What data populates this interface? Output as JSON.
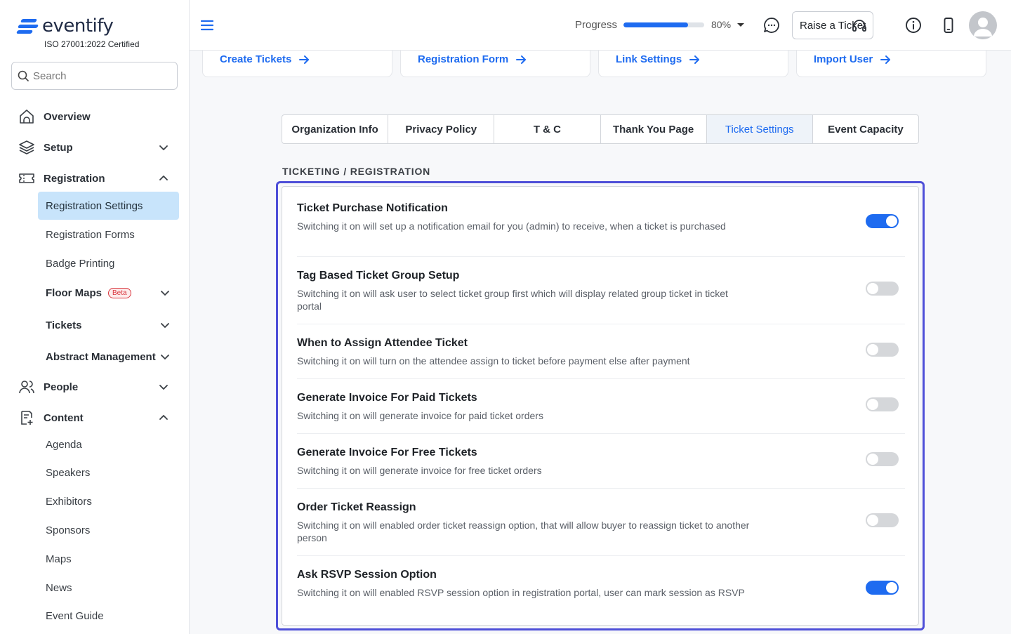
{
  "brand": {
    "name": "eventify",
    "cert": "ISO 27001:2022 Certified"
  },
  "search": {
    "placeholder": "Search"
  },
  "sidebar": {
    "items": [
      {
        "label": "Overview"
      },
      {
        "label": "Setup"
      },
      {
        "label": "Registration"
      },
      {
        "label": "People"
      },
      {
        "label": "Content"
      }
    ],
    "registration_sub": [
      {
        "label": "Registration Settings"
      },
      {
        "label": "Registration Forms"
      },
      {
        "label": "Badge Printing"
      },
      {
        "label": "Floor Maps",
        "badge": "Beta"
      },
      {
        "label": "Tickets"
      },
      {
        "label": "Abstract Management"
      }
    ],
    "content_sub": [
      {
        "label": "Agenda"
      },
      {
        "label": "Speakers"
      },
      {
        "label": "Exhibitors"
      },
      {
        "label": "Sponsors"
      },
      {
        "label": "Maps"
      },
      {
        "label": "News"
      },
      {
        "label": "Event Guide"
      }
    ]
  },
  "header": {
    "progress_label": "Progress",
    "progress_value": 0.8,
    "progress_text": "80%",
    "raise_ticket": "Raise a Ticket"
  },
  "quick_links": [
    {
      "label": "Create Tickets"
    },
    {
      "label": "Registration Form"
    },
    {
      "label": "Link Settings"
    },
    {
      "label": "Import User"
    }
  ],
  "tabs": [
    {
      "label": "Organization Info"
    },
    {
      "label": "Privacy Policy"
    },
    {
      "label": "T & C"
    },
    {
      "label": "Thank You Page"
    },
    {
      "label": "Ticket Settings",
      "active": true
    },
    {
      "label": "Event Capacity"
    }
  ],
  "section_title": "TICKETING / REGISTRATION",
  "settings": [
    {
      "title": "Ticket Purchase Notification",
      "desc": "Switching it on will set up a notification email for you (admin) to receive, when a ticket is purchased",
      "on": true
    },
    {
      "title": "Tag Based Ticket Group Setup",
      "desc": "Switching it on will ask user to select ticket group first which will display related group ticket in ticket portal",
      "on": false
    },
    {
      "title": "When to Assign Attendee Ticket",
      "desc": "Switching it on will turn on the attendee assign to ticket before payment else after payment",
      "on": false
    },
    {
      "title": "Generate Invoice For Paid Tickets",
      "desc": "Switching it on will generate invoice for paid ticket orders",
      "on": false
    },
    {
      "title": "Generate Invoice For Free Tickets",
      "desc": "Switching it on will generate invoice for free ticket orders",
      "on": false
    },
    {
      "title": "Order Ticket Reassign",
      "desc": "Switching it on will enabled order ticket reassign option, that will allow buyer to reassign ticket to another person",
      "on": false
    },
    {
      "title": "Ask RSVP Session Option",
      "desc": "Switching it on will enabled RSVP session option in registration portal, user can mark session as RSVP",
      "on": true
    }
  ],
  "colors": {
    "accent": "#1e6bf0",
    "focus_border": "#4e4fd8",
    "active_nav": "#c8e4fb"
  }
}
